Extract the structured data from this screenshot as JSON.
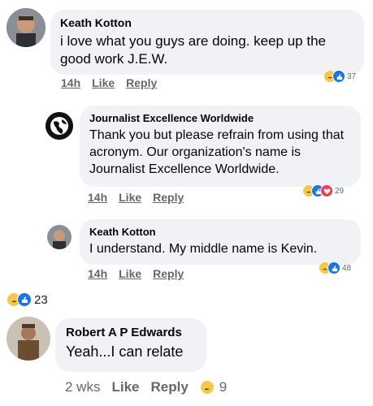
{
  "comments": [
    {
      "author": "Keath Kotton",
      "text": "i love what you guys are doing.  keep up the good work J.E.W.",
      "time": "14h",
      "like": "Like",
      "reply": "Reply",
      "reaction_count": "37"
    },
    {
      "author": "Journalist Excellence Worldwide",
      "text": "Thank you but please refrain from using that acronym. Our organization's name is Journalist Excellence Worldwide.",
      "time": "14h",
      "like": "Like",
      "reply": "Reply",
      "reaction_count": "29"
    },
    {
      "author": "Keath Kotton",
      "text": "I understand.  My middle name is Kevin.",
      "time": "14h",
      "like": "Like",
      "reply": "Reply",
      "reaction_count": "48"
    }
  ],
  "thread_reaction_count": "23",
  "bottom_comment": {
    "author": "Robert A P Edwards",
    "text": "Yeah...I can relate",
    "time": "2 wks",
    "like": "Like",
    "reply": "Reply",
    "reaction_count": "9"
  },
  "colors": {
    "bubble": "#f0f2f5",
    "like_blue": "#1b74e4",
    "haha_yellow": "#f7c74a",
    "love_red": "#f33e58"
  },
  "icons": [
    "haha-icon",
    "like-icon",
    "love-icon",
    "globe-icon"
  ]
}
